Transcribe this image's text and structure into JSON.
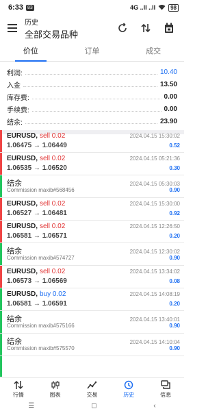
{
  "status_bar": {
    "time": "6:33",
    "badge": "83",
    "network": "4G ..ll ..ll",
    "battery": "98"
  },
  "header": {
    "title": "历史",
    "subtitle": "全部交易品种"
  },
  "tabs": [
    {
      "label": "价位"
    },
    {
      "label": "订单"
    },
    {
      "label": "成交"
    }
  ],
  "summary": [
    {
      "label": "利润:",
      "value": "10.40"
    },
    {
      "label": "入金",
      "value": "13.50"
    },
    {
      "label": "库存费:",
      "value": "0.00"
    },
    {
      "label": "手续费:",
      "value": "0.00"
    },
    {
      "label": "结余:",
      "value": "23.90"
    }
  ],
  "list": [
    {
      "kind": "trade",
      "symbol": "EURUSD,",
      "side": "sell 0.02",
      "time": "2024.04.15 15:30:02",
      "prices": "1.06475 → 1.06449",
      "profit": "0.52"
    },
    {
      "kind": "trade",
      "symbol": "EURUSD,",
      "side": "sell 0.02",
      "time": "2024.04.15 05:21:36",
      "prices": "1.06535 → 1.06520",
      "profit": "0.30"
    },
    {
      "kind": "balance",
      "title": "结余",
      "time": "2024.04.15 05:30:03",
      "comment": "Commission maxib#568456",
      "profit": "0.90"
    },
    {
      "kind": "trade",
      "symbol": "EURUSD,",
      "side": "sell 0.02",
      "time": "2024.04.15 15:30:00",
      "prices": "1.06527 → 1.06481",
      "profit": "0.92"
    },
    {
      "kind": "trade",
      "symbol": "EURUSD,",
      "side": "sell 0.02",
      "time": "2024.04.15 12:26:50",
      "prices": "1.06581 → 1.06571",
      "profit": "0.20"
    },
    {
      "kind": "balance",
      "title": "结余",
      "time": "2024.04.15 12:30:02",
      "comment": "Commission maxib#574727",
      "profit": "0.90"
    },
    {
      "kind": "trade",
      "symbol": "EURUSD,",
      "side": "sell 0.02",
      "time": "2024.04.15 13:34:02",
      "prices": "1.06573 → 1.06569",
      "profit": "0.08"
    },
    {
      "kind": "trade",
      "symbol": "EURUSD,",
      "side": "buy 0.02",
      "time": "2024.04.15 14:08:19",
      "prices": "1.06581 → 1.06591",
      "profit": "0.20"
    },
    {
      "kind": "balance",
      "title": "结余",
      "time": "2024.04.15 13:40:01",
      "comment": "Commission maxib#575166",
      "profit": "0.90"
    },
    {
      "kind": "balance",
      "title": "结余",
      "time": "2024.04.15 14:10:04",
      "comment": "Commission maxib#575570",
      "profit": "0.90"
    },
    {
      "kind": "balance",
      "title": "",
      "time": "",
      "comment": "",
      "profit": ""
    }
  ],
  "bottom_nav": [
    {
      "label": "行情",
      "icon": "arrows-updown-icon"
    },
    {
      "label": "图表",
      "icon": "candles-icon"
    },
    {
      "label": "交易",
      "icon": "trend-icon"
    },
    {
      "label": "历史",
      "icon": "history-icon"
    },
    {
      "label": "信息",
      "icon": "chat-icon"
    }
  ],
  "colors": {
    "accent": "#1c6ef2",
    "sell": "#e03131",
    "bar_red": "#ef4444",
    "bar_green": "#22c55e"
  }
}
